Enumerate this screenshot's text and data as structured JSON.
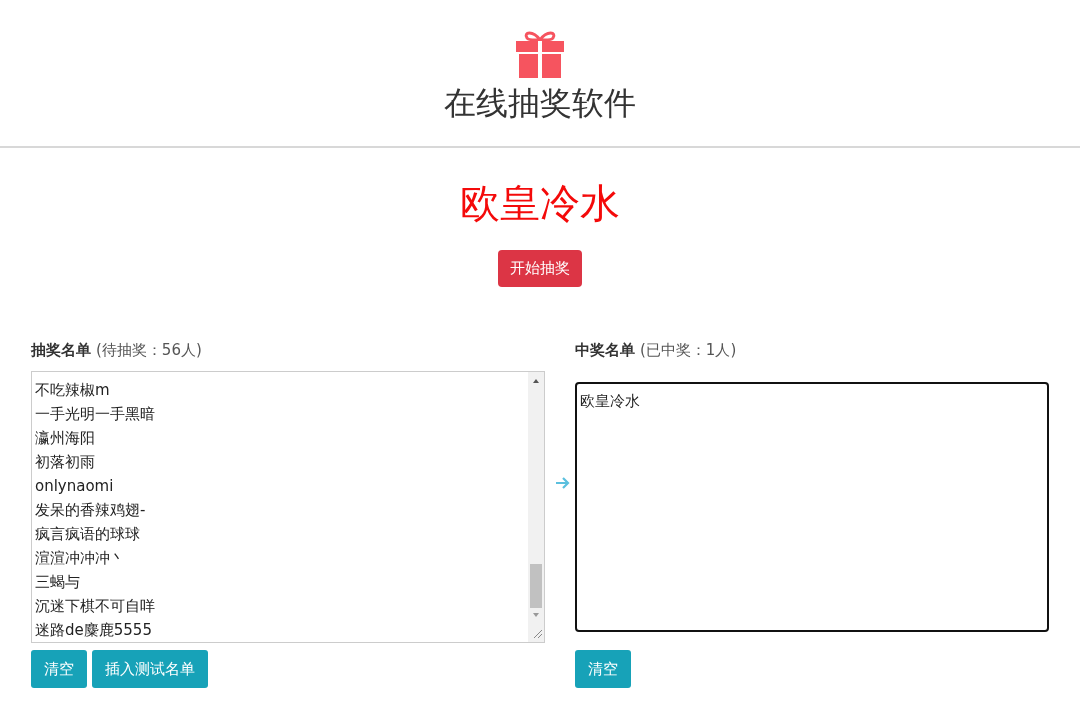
{
  "header": {
    "title": "在线抽奖软件"
  },
  "winner_display": "欧皇冷水",
  "start_button": "开始抽奖",
  "pool": {
    "label": "抽奖名单",
    "count": "(待抽奖：56人)",
    "names": [
      "不吃辣椒m",
      "一手光明一手黑暗",
      "瀛州海阳",
      "初落初雨",
      "onlynaomi",
      "发呆的香辣鸡翅-",
      "疯言疯语的球球",
      "渲渲冲冲冲丶",
      "三蝎与",
      "沉迷下棋不可自咩",
      "迷路de麋鹿5555"
    ],
    "buttons": [
      "清空",
      "插入测试名单"
    ]
  },
  "winners": {
    "label": "中奖名单",
    "count": "(已中奖：1人)",
    "names": [
      "欧皇冷水"
    ],
    "focused": true,
    "buttons": [
      "清空"
    ]
  }
}
